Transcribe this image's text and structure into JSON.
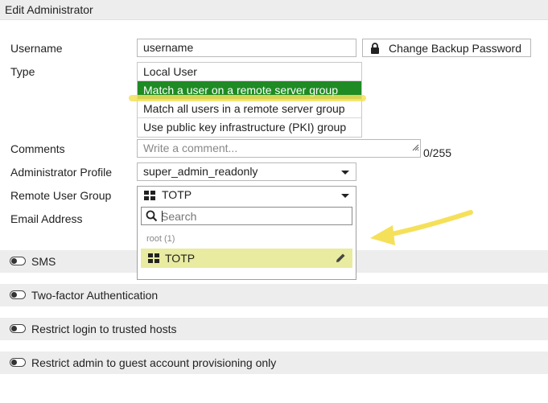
{
  "window": {
    "title": "Edit Administrator"
  },
  "form": {
    "username_label": "Username",
    "username_value": "username",
    "change_backup_password_label": "Change Backup Password",
    "type_label": "Type",
    "type_options": [
      "Local User",
      "Match a user on a remote server group",
      "Match all users in a remote server group",
      "Use public key infrastructure (PKI) group"
    ],
    "type_selected_index": 1,
    "comments_label": "Comments",
    "comments_placeholder": "Write a comment...",
    "comments_counter": "0/255",
    "admin_profile_label": "Administrator Profile",
    "admin_profile_value": "super_admin_readonly",
    "remote_group_label": "Remote User Group",
    "remote_group_value": "TOTP",
    "email_label": "Email Address"
  },
  "dropdown": {
    "search_placeholder": "Search",
    "group_header": "root (1)",
    "items": [
      {
        "label": "TOTP",
        "highlighted": true
      }
    ]
  },
  "sections": [
    {
      "label": "SMS",
      "enabled": false
    },
    {
      "label": "Two-factor Authentication",
      "enabled": false
    },
    {
      "label": "Restrict login to trusted hosts",
      "enabled": false
    },
    {
      "label": "Restrict admin to guest account provisioning only",
      "enabled": false
    }
  ],
  "colors": {
    "selected_option": "#1f8b24",
    "highlight": "#e8eba0",
    "annotation": "#f5e05a"
  },
  "icons": [
    "lock-icon",
    "search-icon",
    "grid-icon",
    "pencil-icon",
    "chevron-down-icon",
    "resize-grip-icon",
    "arrow-annotation"
  ]
}
